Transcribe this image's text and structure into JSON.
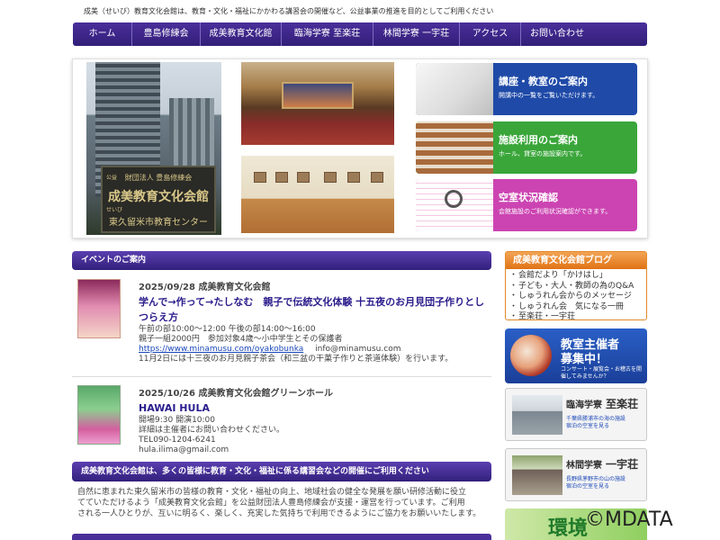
{
  "header": {
    "tagline": "成美（せいび）教育文化会館は、教育・文化・福祉にかかわる講習会の開催など、公益事業の推進を目的としてご利用ください"
  },
  "nav": {
    "items": [
      "ホーム",
      "豊島修練会",
      "成美教育文化館",
      "臨海学寮 至楽荘",
      "林間学寮 一宇荘",
      "アクセス",
      "お問い合わせ"
    ]
  },
  "hero": {
    "sign": {
      "line1": "公益",
      "line2": "財団法人 豊島修練会",
      "line3": "成美教育文化会館",
      "line4": "せいび",
      "line5": "東久留米市教育センター"
    },
    "cards": [
      {
        "title": "講座・教室のご案内",
        "subtitle": "開講中の一覧をご覧いただけます。"
      },
      {
        "title": "施設利用のご案内",
        "subtitle": "ホール、貸室の施設案内です。"
      },
      {
        "title": "空室状況確認",
        "subtitle": "会館施設のご利用状況確認ができます。"
      }
    ]
  },
  "events": {
    "heading": "イベントのご案内",
    "items": [
      {
        "date": "2025/09/28 成美教育文化会館",
        "title": "学んで→作って→たしなむ　親子で伝統文化体験 十五夜のお月見団子作りとしつらえ方",
        "lines": [
          "午前の部10:00〜12:00 午後の部14:00〜16:00",
          "親子一組2000円　参加対象4歳〜小中学生とその保護者"
        ],
        "link": "https://www.minamusu.com/oyakobunka",
        "email": "info@minamusu.com",
        "note": "11月2日には十三夜のお月見親子茶会（和三盆の干菓子作りと茶道体験）を行います。"
      },
      {
        "date": "2025/10/26 成美教育文化会館グリーンホール",
        "title": "HAWAI HULA",
        "lines": [
          "開場9:30 開演10:00",
          "詳細は主催者にお問い合わせください。",
          "TEL090-1204-6241",
          "hula.ilima@gmail.com"
        ]
      }
    ]
  },
  "info": {
    "heading": "成美教育文化会館は、多くの皆様に教育・文化・福祉に係る講習会などの開催にご利用ください",
    "lines": [
      "自然に恵まれた東久留米市の皆様の教育・文化・福祉の向上、地域社会の健全な発展を願い研修活動に役立",
      "てていただけるよう「成美教育文化会館」を公益財団法人豊島修練会が支援・運営を行っています。ご利用",
      "される一人ひとりが、互いに明るく、楽しく、充実した気持ちで利用できるようにご協力をお願いいたします。"
    ]
  },
  "sidebar": {
    "blog": {
      "title": "成美教育文化会館ブログ",
      "items": [
        "会館だより「かけはし」",
        "子ども・大人・教師の為のQ&A",
        "しゅうれん会からのメッセージ",
        "しゅうれん会　気になる一冊",
        "至楽荘・一宇荘"
      ]
    },
    "recruit": {
      "title1": "教室主催者",
      "title2": "募集中！",
      "subtitle": "コンサート・展覧会・お稽古を開催してみませんか？"
    },
    "lodges": [
      {
        "prefix": "臨海学寮",
        "name": "至楽荘",
        "sub1": "千葉県勝浦市の海の施設",
        "sub2": "宿泊の空室を見る"
      },
      {
        "prefix": "林間学寮",
        "name": "一宇荘",
        "sub1": "長野県茅野市の山の施設",
        "sub2": "宿泊の空室を見る"
      }
    ],
    "env": {
      "label": "環境"
    }
  },
  "watermark": "©MDATA",
  "colors": {
    "nav": "#3d2689",
    "accent_orange": "#e07316",
    "blue": "#1f4aa8",
    "green": "#3aa63a",
    "magenta": "#cc44b2"
  }
}
